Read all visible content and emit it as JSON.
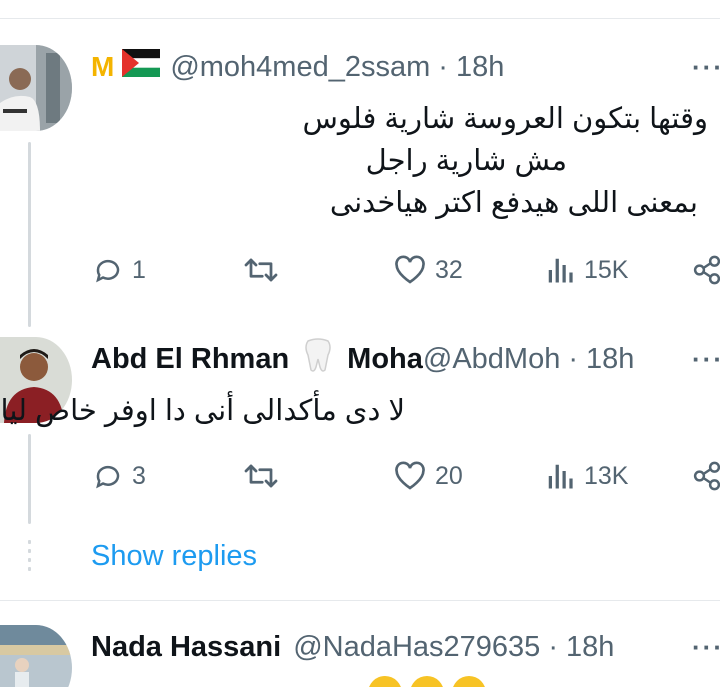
{
  "tweets": [
    {
      "handle": "@moh4med_2ssam",
      "sep": "·",
      "time": "18h",
      "badge_text": "M",
      "lines": [
        "وقتها بتكون العروسة شارية فلوس",
        "مش شارية راجل",
        "بمعنى اللى هيدفع اكتر هياخدنى"
      ],
      "replies": "1",
      "likes": "32",
      "views": "15K"
    },
    {
      "name": "Abd El Rhman",
      "name_suffix": "Moha",
      "handle": "@AbdMoh",
      "sep": "·",
      "time": "18h",
      "lines": [
        "لا دى مأكدالى أنى دا اوفر خاص ليا"
      ],
      "replies": "3",
      "likes": "20",
      "views": "13K"
    },
    {
      "name": "Nada Hassani",
      "handle": "@NadaHas279635",
      "sep": "·",
      "time": "18h"
    }
  ],
  "show_replies": "Show replies",
  "more_label": "···",
  "colors": {
    "link": "#1d9bf0",
    "muted": "#536471",
    "text": "#0f1419"
  },
  "icons": [
    "reply-icon",
    "retweet-icon",
    "like-icon",
    "views-icon",
    "share-icon",
    "more-icon",
    "palestine-flag-icon",
    "tooth-emoji-icon"
  ]
}
